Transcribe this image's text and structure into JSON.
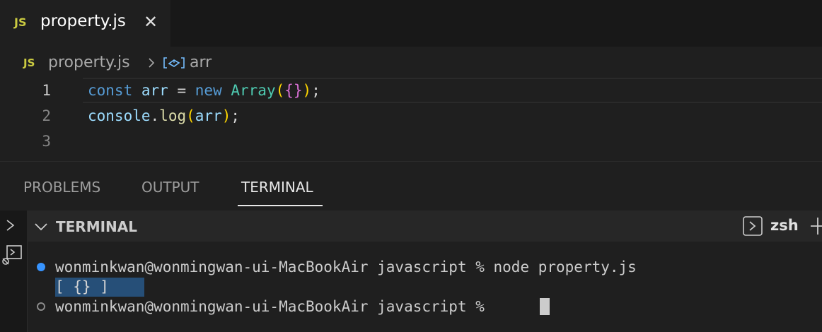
{
  "tab": {
    "badge": "JS",
    "title": "property.js",
    "close": "✕"
  },
  "breadcrumb": {
    "badge": "JS",
    "file": "property.js",
    "symbol": "arr"
  },
  "editor": {
    "line_numbers": [
      "1",
      "2",
      "3"
    ],
    "line1": {
      "kw1": "const",
      "var": "arr",
      "eq": "=",
      "kw2": "new",
      "cls": "Array",
      "po": "(",
      "br": "{}",
      "pc": ")",
      "semi": ";"
    },
    "line2": {
      "obj": "console",
      "dot": ".",
      "fn": "log",
      "po": "(",
      "arg": "arr",
      "pc": ")",
      "semi": ";"
    }
  },
  "panel": {
    "tabs": [
      "PROBLEMS",
      "OUTPUT",
      "TERMINAL"
    ],
    "active_tab": "TERMINAL"
  },
  "terminal": {
    "header_title": "TERMINAL",
    "shell_name": "zsh",
    "lines": [
      "wonminkwan@wonmingwan-ui-MacBookAir javascript % node property.js",
      "[ {} ]",
      "wonminkwan@wonmingwan-ui-MacBookAir javascript % "
    ]
  },
  "colors": {
    "accent": "#3794ff",
    "selection": "#264f78",
    "js_badge": "#cbcb41"
  }
}
